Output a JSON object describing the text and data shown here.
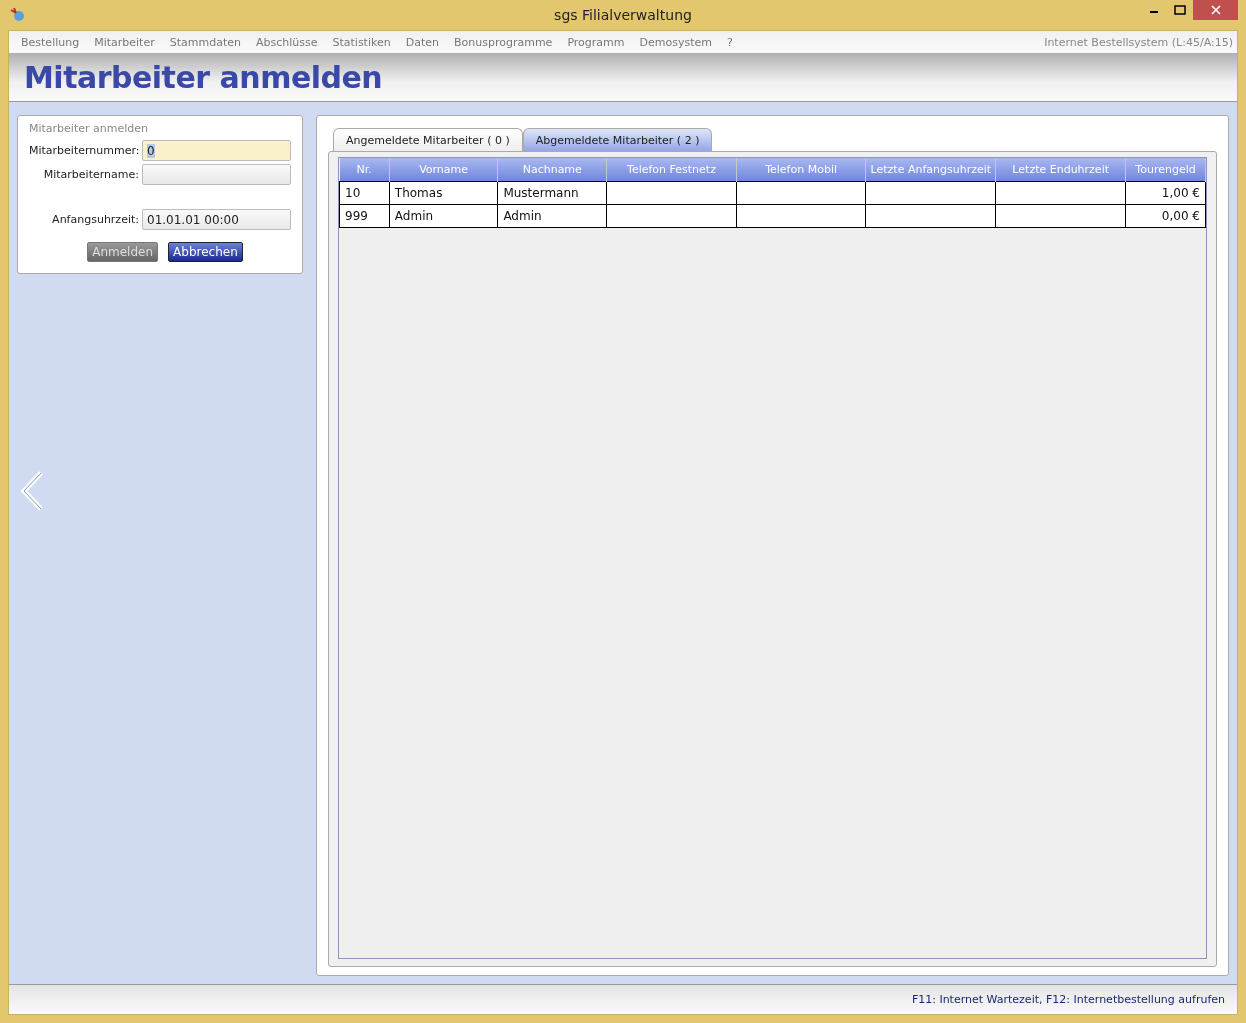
{
  "window": {
    "title": "sgs Filialverwaltung"
  },
  "menu": [
    "Bestellung",
    "Mitarbeiter",
    "Stammdaten",
    "Abschlüsse",
    "Statistiken",
    "Daten",
    "Bonusprogramme",
    "Programm",
    "Demosystem",
    "?"
  ],
  "system_info": "Internet Bestellsystem (L:45/A:15)",
  "page_title": "Mitarbeiter anmelden",
  "form": {
    "title": "Mitarbeiter anmelden",
    "fields": [
      {
        "label": "Mitarbeiternummer:",
        "value": "0",
        "focused": true
      },
      {
        "label": "Mitarbeitername:",
        "focused": false
      },
      {
        "label": "Anfangsuhrzeit:",
        "value": "01.01.01 00:00",
        "focused": false
      }
    ],
    "buttons": [
      {
        "label": "Anmelden",
        "disabled": true
      },
      {
        "label": "Abbrechen",
        "disabled": false
      }
    ]
  },
  "tabs": [
    {
      "label": "Angemeldete Mitarbeiter ( 0 )",
      "selected": false
    },
    {
      "label": "Abgemeldete Mitarbeiter ( 2 )",
      "selected": true
    }
  ],
  "table": {
    "columns": [
      {
        "label": "Nr.",
        "kind": "text"
      },
      {
        "label": "Vorname",
        "kind": "text"
      },
      {
        "label": "Nachname",
        "kind": "text"
      },
      {
        "label": "Telefon Festnetz",
        "kind": "text"
      },
      {
        "label": "Telefon Mobil",
        "kind": "text"
      },
      {
        "label": "Letzte Anfangsuhrzeit",
        "kind": "text"
      },
      {
        "label": "Letzte Enduhrzeit",
        "kind": "text"
      },
      {
        "label": "Tourengeld",
        "kind": "amount"
      }
    ],
    "rows": [
      [
        "10",
        "Thomas",
        "Mustermann",
        "",
        "",
        "",
        "",
        "1,00 €"
      ],
      [
        "999",
        "Admin",
        "Admin",
        "",
        "",
        "",
        "",
        "0,00 €"
      ]
    ]
  },
  "status_bar": "F11: Internet Wartezeit, F12: Internetbestellung aufrufen"
}
